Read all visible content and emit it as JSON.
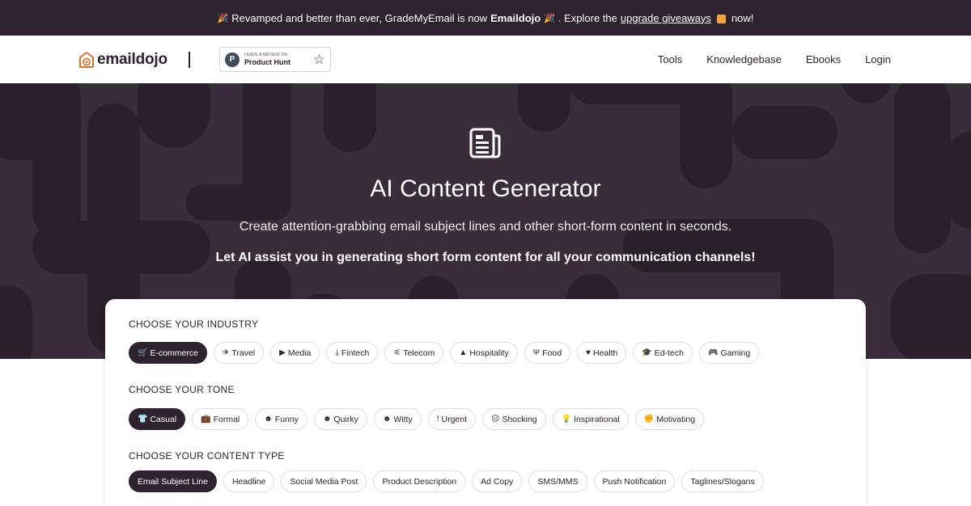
{
  "announcement": {
    "part1": "Revamped and better than ever, GradeMyEmail is now",
    "brand": "Emaildojo",
    "part2": ". Explore the",
    "link": "upgrade giveaways",
    "part3": "now!"
  },
  "header": {
    "logo_text": "emaildojo",
    "product_hunt": {
      "small": "LEAVE A REVIEW ON",
      "big": "Product Hunt",
      "letter": "P"
    },
    "nav": [
      "Tools",
      "Knowledgebase",
      "Ebooks",
      "Login"
    ]
  },
  "hero": {
    "title": "AI Content Generator",
    "subtitle": "Create attention-grabbing email subject lines and other short-form content in seconds.",
    "tagline": "Let AI assist you in generating short form content for all your communication channels!"
  },
  "industry": {
    "label": "CHOOSE YOUR INDUSTRY",
    "options": [
      {
        "label": "E-commerce",
        "icon": "cart-icon",
        "glyph": "🛒",
        "active": true
      },
      {
        "label": "Travel",
        "icon": "plane-icon",
        "glyph": "✈",
        "active": false
      },
      {
        "label": "Media",
        "icon": "play-icon",
        "glyph": "▶",
        "active": false
      },
      {
        "label": "Fintech",
        "icon": "hand-coin-icon",
        "glyph": "⤓",
        "active": false
      },
      {
        "label": "Telecom",
        "icon": "satellite-icon",
        "glyph": "⚟",
        "active": false
      },
      {
        "label": "Hospitality",
        "icon": "bell-icon",
        "glyph": "▲",
        "active": false
      },
      {
        "label": "Food",
        "icon": "utensils-icon",
        "glyph": "Ψ",
        "active": false
      },
      {
        "label": "Health",
        "icon": "heart-icon",
        "glyph": "♥",
        "active": false
      },
      {
        "label": "Ed-tech",
        "icon": "grad-cap-icon",
        "glyph": "🎓",
        "active": false
      },
      {
        "label": "Gaming",
        "icon": "gamepad-icon",
        "glyph": "🎮",
        "active": false
      }
    ]
  },
  "tone": {
    "label": "CHOOSE YOUR TONE",
    "options": [
      {
        "label": "Casual",
        "icon": "tshirt-icon",
        "glyph": "👕",
        "active": true
      },
      {
        "label": "Formal",
        "icon": "briefcase-icon",
        "glyph": "💼",
        "active": false
      },
      {
        "label": "Funny",
        "icon": "laugh-icon",
        "glyph": "☻",
        "active": false
      },
      {
        "label": "Quirky",
        "icon": "grin-icon",
        "glyph": "☻",
        "active": false
      },
      {
        "label": "Witty",
        "icon": "smile-icon",
        "glyph": "☻",
        "active": false
      },
      {
        "label": "Urgent",
        "icon": "exclamation-icon",
        "glyph": "!",
        "active": false
      },
      {
        "label": "Shocking",
        "icon": "surprise-icon",
        "glyph": "☹",
        "active": false
      },
      {
        "label": "Inspirational",
        "icon": "lightbulb-icon",
        "glyph": "💡",
        "active": false
      },
      {
        "label": "Motivating",
        "icon": "fist-icon",
        "glyph": "✊",
        "active": false
      }
    ]
  },
  "content_type": {
    "label": "CHOOSE YOUR CONTENT TYPE",
    "options": [
      {
        "label": "Email Subject Line",
        "active": true
      },
      {
        "label": "Headline",
        "active": false
      },
      {
        "label": "Social Media Post",
        "active": false
      },
      {
        "label": "Product Description",
        "active": false
      },
      {
        "label": "Ad Copy",
        "active": false
      },
      {
        "label": "SMS/MMS",
        "active": false
      },
      {
        "label": "Push Notification",
        "active": false
      },
      {
        "label": "Taglines/Slogans",
        "active": false
      }
    ]
  },
  "colors": {
    "dark": "#2e2230",
    "hero": "#3a2c3a",
    "hero_pattern": "#2a1f2a",
    "accent": "#e0702b"
  }
}
